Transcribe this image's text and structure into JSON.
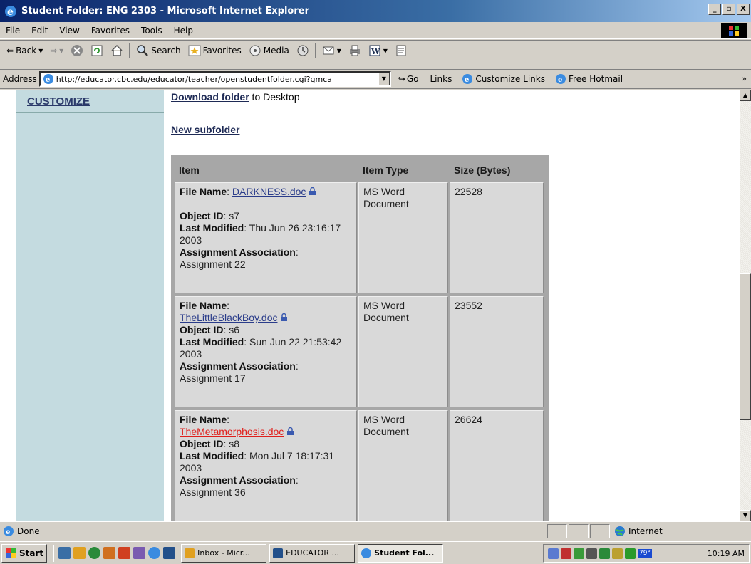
{
  "window": {
    "title": "Student Folder: ENG 2303 - Microsoft Internet Explorer",
    "controls": [
      "_",
      "▫",
      "X"
    ]
  },
  "menu": [
    "File",
    "Edit",
    "View",
    "Favorites",
    "Tools",
    "Help"
  ],
  "toolbar": {
    "back": "Back",
    "search": "Search",
    "favorites": "Favorites",
    "media": "Media"
  },
  "address": {
    "label": "Address",
    "url": "http://educator.cbc.edu/educator/teacher/openstudentfolder.cgi?gmca",
    "go": "Go",
    "links_label": "Links",
    "links": [
      "Customize Links",
      "Free Hotmail"
    ]
  },
  "sidebar": {
    "customize": "CUSTOMIZE"
  },
  "page": {
    "download_link": "Download folder",
    "download_suffix": " to Desktop",
    "new_subfolder": "New subfolder",
    "columns": [
      "Item",
      "Item Type",
      "Size (Bytes)"
    ],
    "labels": {
      "file_name": "File Name",
      "object_id": "Object ID",
      "last_modified": "Last Modified",
      "assignment": "Assignment Association"
    },
    "rows": [
      {
        "file": "DARKNESS.doc",
        "object_id": "s7",
        "modified": "Thu Jun 26 23:16:17 2003",
        "assignment": "Assignment 22",
        "type": "MS Word Document",
        "size": "22528"
      },
      {
        "file": "TheLittleBlackBoy.doc",
        "object_id": "s6",
        "modified": "Sun Jun 22 21:53:42 2003",
        "assignment": "Assignment 17",
        "type": "MS Word Document",
        "size": "23552"
      },
      {
        "file": "TheMetamorphosis.doc",
        "object_id": "s8",
        "modified": "Mon Jul 7 18:17:31 2003",
        "assignment": "Assignment 36",
        "type": "MS Word Document",
        "size": "26624"
      }
    ]
  },
  "status": {
    "text": "Done",
    "zone": "Internet"
  },
  "taskbar": {
    "start": "Start",
    "tasks": [
      "Inbox - Micr...",
      "EDUCATOR ...",
      "Student Fol..."
    ],
    "tray_temp": "79°",
    "clock": "10:19 AM"
  },
  "colors": {
    "sidebar": "#c4dbe0",
    "link": "#2a3c8a",
    "visited_link": "#e0201c",
    "table_bg": "#a7a7a7",
    "cell_bg": "#d9d9d9"
  }
}
